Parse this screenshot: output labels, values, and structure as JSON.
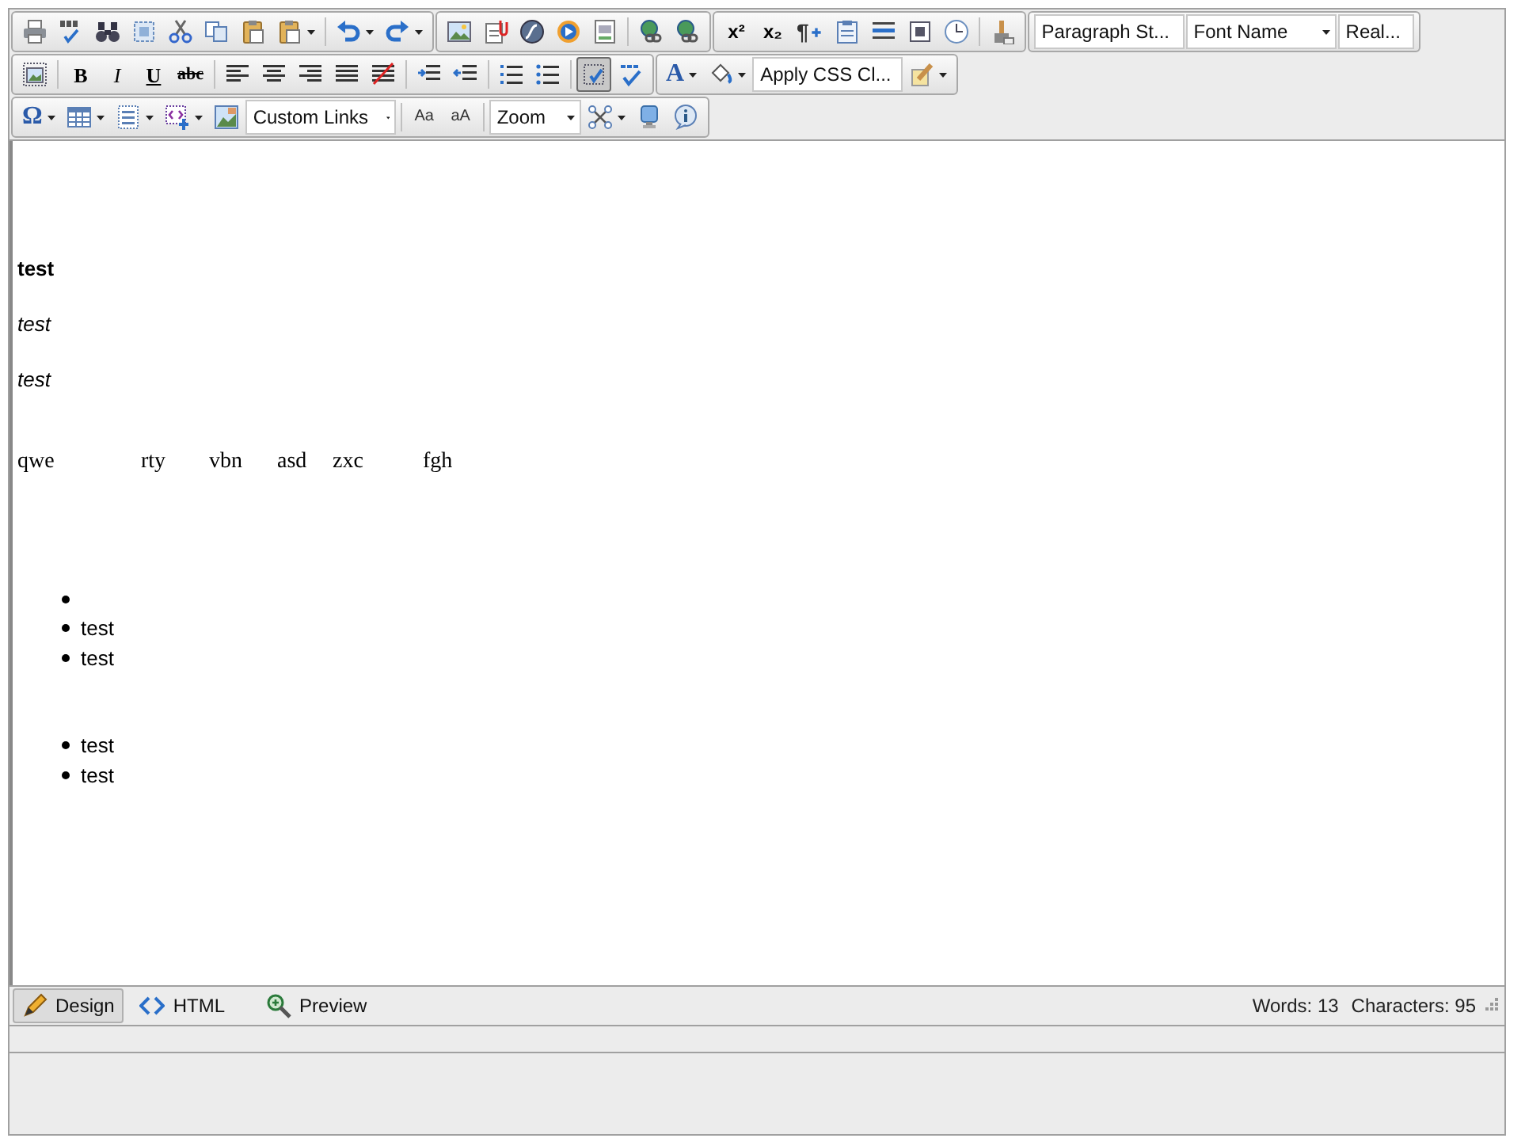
{
  "toolbars": [
    [
      {
        "items": [
          {
            "kind": "button"
          },
          {
            "kind": "button"
          },
          {
            "kind": "button"
          },
          {
            "kind": "button"
          },
          {
            "kind": "button"
          },
          {
            "kind": "button"
          },
          {
            "kind": "button"
          },
          {
            "kind": "split"
          },
          {
            "kind": "separator"
          },
          {
            "kind": "split"
          },
          {
            "kind": "split"
          }
        ]
      },
      {
        "items": [
          {
            "kind": "button"
          },
          {
            "kind": "button"
          },
          {
            "kind": "button"
          },
          {
            "kind": "button"
          },
          {
            "kind": "button"
          },
          {
            "kind": "separator"
          },
          {
            "kind": "button"
          },
          {
            "kind": "button"
          }
        ]
      },
      {
        "items": [
          {
            "kind": "toggle",
            "glyph": "x²",
            "pressed": false
          },
          {
            "kind": "toggle",
            "glyph": "x₂",
            "pressed": false
          },
          {
            "kind": "button",
            "glyph": "¶"
          },
          {
            "kind": "button"
          },
          {
            "kind": "button"
          },
          {
            "kind": "button"
          },
          {
            "kind": "button"
          },
          {
            "kind": "separator"
          },
          {
            "kind": "button"
          }
        ]
      },
      {
        "items": [
          {
            "kind": "dropdown",
            "text": "Paragraph St..."
          },
          {
            "kind": "dropdown",
            "text": "Font Name"
          },
          {
            "kind": "dropdown",
            "text": "Real..."
          }
        ]
      }
    ],
    [
      {
        "items": [
          {
            "kind": "button"
          },
          {
            "kind": "separator"
          },
          {
            "kind": "toggle",
            "glyph": "B",
            "pressed": false
          },
          {
            "kind": "toggle",
            "glyph": "I",
            "pressed": false
          },
          {
            "kind": "toggle",
            "glyph": "U",
            "pressed": false
          },
          {
            "kind": "toggle",
            "glyph": "abc",
            "pressed": false
          },
          {
            "kind": "separator"
          },
          {
            "kind": "toggle",
            "pressed": false
          },
          {
            "kind": "toggle",
            "pressed": false
          },
          {
            "kind": "toggle",
            "pressed": false
          },
          {
            "kind": "toggle",
            "pressed": false
          },
          {
            "kind": "button"
          },
          {
            "kind": "separator"
          },
          {
            "kind": "button"
          },
          {
            "kind": "button"
          },
          {
            "kind": "separator"
          },
          {
            "kind": "toggle",
            "pressed": false
          },
          {
            "kind": "toggle",
            "pressed": false
          },
          {
            "kind": "separator"
          },
          {
            "kind": "toggle",
            "pressed": true
          },
          {
            "kind": "button"
          }
        ]
      },
      {
        "items": [
          {
            "kind": "split",
            "glyph": "A"
          },
          {
            "kind": "split"
          },
          {
            "kind": "dropdown",
            "text": "Apply CSS Cl..."
          },
          {
            "kind": "split"
          }
        ]
      }
    ],
    [
      {
        "items": [
          {
            "kind": "split",
            "glyph": "Ω"
          },
          {
            "kind": "split"
          },
          {
            "kind": "split"
          },
          {
            "kind": "split"
          },
          {
            "kind": "button"
          },
          {
            "kind": "dropdown",
            "text": "Custom Links"
          },
          {
            "kind": "separator"
          },
          {
            "kind": "button",
            "glyph": "Aa"
          },
          {
            "kind": "button",
            "glyph": "aA"
          },
          {
            "kind": "separator"
          },
          {
            "kind": "dropdown",
            "text": "Zoom"
          },
          {
            "kind": "split"
          },
          {
            "kind": "button"
          },
          {
            "kind": "button"
          }
        ]
      }
    ]
  ],
  "content": [
    {
      "kind": "bold_paragraph",
      "text": "test"
    },
    {
      "kind": "italic_paragraph",
      "text": "test"
    },
    {
      "kind": "italic_paragraph",
      "text": "test"
    },
    {
      "kind": "spaced_words",
      "words": [
        "qwe",
        "rty",
        "vbn",
        "asd",
        "zxc",
        "fgh"
      ]
    },
    {
      "kind": "list",
      "items": [
        {
          "kind": "empty"
        },
        {
          "kind": "text",
          "text": "test"
        },
        {
          "kind": "text",
          "text": "test"
        }
      ]
    },
    {
      "kind": "list",
      "items": [
        {
          "kind": "text",
          "text": "test"
        },
        {
          "kind": "text",
          "text": "test"
        }
      ]
    }
  ],
  "modes": [
    {
      "label": "Design",
      "selected": true
    },
    {
      "label": "HTML",
      "selected": false
    },
    {
      "label": "Preview",
      "selected": false
    }
  ],
  "status": {
    "words": "Words: 13",
    "characters": "Characters: 95"
  }
}
